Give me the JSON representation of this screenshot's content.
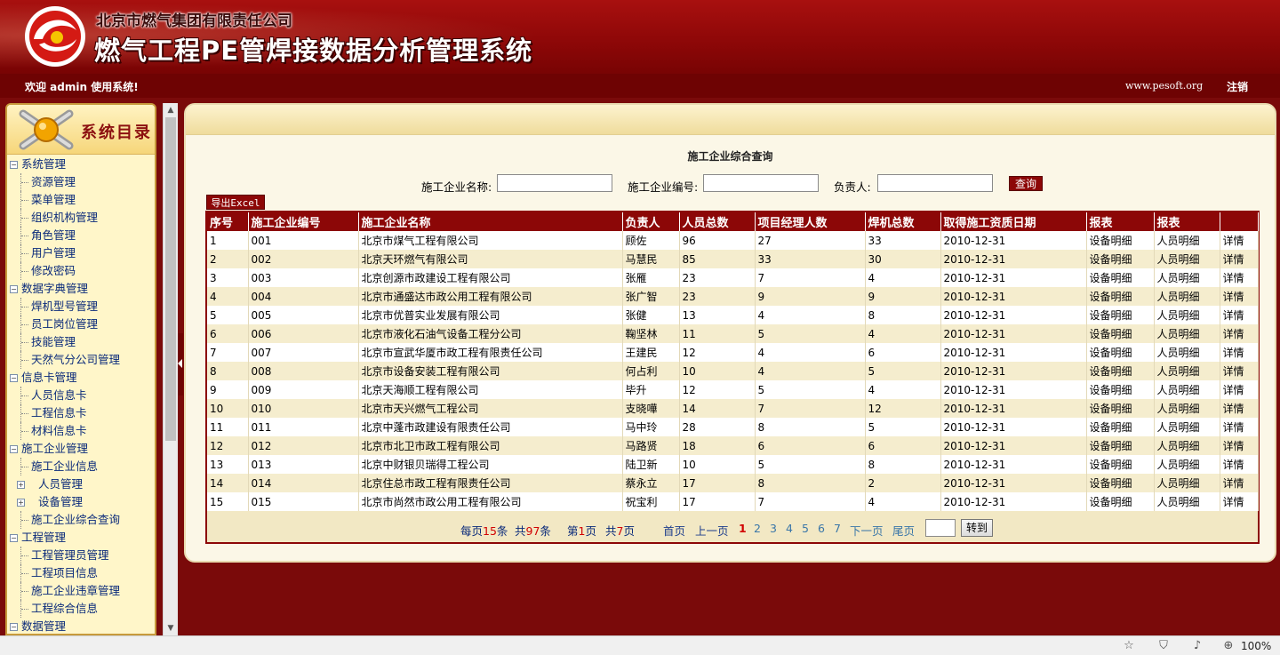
{
  "header": {
    "company": "北京市燃气集团有限责任公司",
    "system_title": "燃气工程PE管焊接数据分析管理系统"
  },
  "topbar": {
    "welcome": "欢迎 admin 使用系统!",
    "site": "www.pesoft.org",
    "logout": "注销"
  },
  "sidebar": {
    "title": "系统目录",
    "groups": [
      {
        "label": "系统管理",
        "items": [
          "资源管理",
          "菜单管理",
          "组织机构管理",
          "角色管理",
          "用户管理",
          "修改密码"
        ]
      },
      {
        "label": "数据字典管理",
        "items": [
          "焊机型号管理",
          "员工岗位管理",
          "技能管理",
          "天然气分公司管理"
        ]
      },
      {
        "label": "信息卡管理",
        "items": [
          "人员信息卡",
          "工程信息卡",
          "材料信息卡"
        ]
      },
      {
        "label": "施工企业管理",
        "items": [
          "施工企业信息",
          "人员管理",
          "设备管理",
          "施工企业综合查询"
        ]
      },
      {
        "label": "工程管理",
        "items": [
          "工程管理员管理",
          "工程项目信息",
          "施工企业违章管理",
          "工程综合信息"
        ]
      },
      {
        "label": "数据管理",
        "items": []
      }
    ]
  },
  "main": {
    "title": "施工企业综合查询",
    "search": {
      "name_label": "施工企业名称:",
      "code_label": "施工企业编号:",
      "person_label": "负责人:",
      "name_value": "",
      "code_value": "",
      "person_value": "",
      "query_button": "查询"
    },
    "export_button": "导出Excel",
    "table": {
      "headers": [
        "序号",
        "施工企业编号",
        "施工企业名称",
        "负责人",
        "人员总数",
        "项目经理人数",
        "焊机总数",
        "取得施工资质日期",
        "报表",
        "报表",
        ""
      ],
      "rows": [
        [
          "1",
          "001",
          "北京市煤气工程有限公司",
          "顾佐",
          "96",
          "27",
          "33",
          "2010-12-31",
          "设备明细",
          "人员明细",
          "详情"
        ],
        [
          "2",
          "002",
          "北京天环燃气有限公司",
          "马慧民",
          "85",
          "33",
          "30",
          "2010-12-31",
          "设备明细",
          "人员明细",
          "详情"
        ],
        [
          "3",
          "003",
          "北京创源市政建设工程有限公司",
          "张雁",
          "23",
          "7",
          "4",
          "2010-12-31",
          "设备明细",
          "人员明细",
          "详情"
        ],
        [
          "4",
          "004",
          "北京市通盛达市政公用工程有限公司",
          "张广智",
          "23",
          "9",
          "9",
          "2010-12-31",
          "设备明细",
          "人员明细",
          "详情"
        ],
        [
          "5",
          "005",
          "北京市优普实业发展有限公司",
          "张健",
          "13",
          "4",
          "8",
          "2010-12-31",
          "设备明细",
          "人员明细",
          "详情"
        ],
        [
          "6",
          "006",
          "北京市液化石油气设备工程分公司",
          "鞠坚林",
          "11",
          "5",
          "4",
          "2010-12-31",
          "设备明细",
          "人员明细",
          "详情"
        ],
        [
          "7",
          "007",
          "北京市宣武华厦市政工程有限责任公司",
          "王建民",
          "12",
          "4",
          "6",
          "2010-12-31",
          "设备明细",
          "人员明细",
          "详情"
        ],
        [
          "8",
          "008",
          "北京市设备安装工程有限公司",
          "何占利",
          "10",
          "4",
          "5",
          "2010-12-31",
          "设备明细",
          "人员明细",
          "详情"
        ],
        [
          "9",
          "009",
          "北京天海顺工程有限公司",
          "毕升",
          "12",
          "5",
          "4",
          "2010-12-31",
          "设备明细",
          "人员明细",
          "详情"
        ],
        [
          "10",
          "010",
          "北京市天兴燃气工程公司",
          "支晓嘩",
          "14",
          "7",
          "12",
          "2010-12-31",
          "设备明细",
          "人员明细",
          "详情"
        ],
        [
          "11",
          "011",
          "北京中蓬市政建设有限责任公司",
          "马中玲",
          "28",
          "8",
          "5",
          "2010-12-31",
          "设备明细",
          "人员明细",
          "详情"
        ],
        [
          "12",
          "012",
          "北京市北卫市政工程有限公司",
          "马路贤",
          "18",
          "6",
          "6",
          "2010-12-31",
          "设备明细",
          "人员明细",
          "详情"
        ],
        [
          "13",
          "013",
          "北京中财银贝瑞得工程公司",
          "陆卫新",
          "10",
          "5",
          "8",
          "2010-12-31",
          "设备明细",
          "人员明细",
          "详情"
        ],
        [
          "14",
          "014",
          "北京住总市政工程有限责任公司",
          "蔡永立",
          "17",
          "8",
          "2",
          "2010-12-31",
          "设备明细",
          "人员明细",
          "详情"
        ],
        [
          "15",
          "015",
          "北京市尚然市政公用工程有限公司",
          "祝宝利",
          "17",
          "7",
          "4",
          "2010-12-31",
          "设备明细",
          "人员明细",
          "详情"
        ]
      ]
    },
    "pager": {
      "per_page_prefix": "每页",
      "per_page": "15",
      "per_page_suffix": "条",
      "total_prefix": "共",
      "total": "97",
      "total_suffix": "条",
      "page_prefix": "第",
      "page": "1",
      "page_suffix": "页",
      "pages_prefix": "共",
      "pages": "7",
      "pages_suffix": "页",
      "first": "首页",
      "prev": "上一页",
      "numbers": [
        "1",
        "2",
        "3",
        "4",
        "5",
        "6",
        "7"
      ],
      "next": "下一页",
      "last": "尾页",
      "goto_value": "",
      "go_button": "转到"
    }
  },
  "statusbar": {
    "zoom": "100%",
    "icons": [
      "favorite-icon",
      "shield-icon",
      "speaker-icon",
      "zoom-icon"
    ]
  },
  "colors": {
    "brand_red": "#8c0707",
    "panel_cream": "#fbf7e7",
    "link_blue": "#0a2a7a",
    "accent_red": "#d10000"
  }
}
